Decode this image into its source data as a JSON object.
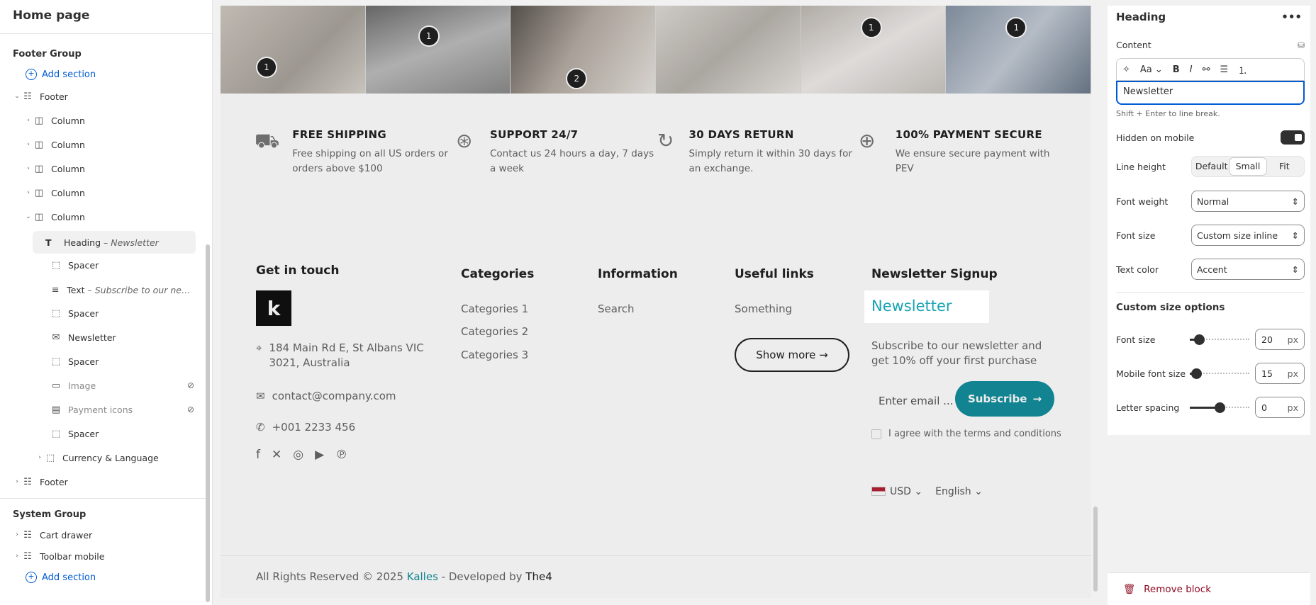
{
  "left_panel": {
    "title": "Home page",
    "footer_group_label": "Footer Group",
    "add_section_top": "Add section",
    "items": [
      {
        "label": "Footer",
        "sub": "",
        "icon": "section-icon"
      },
      {
        "label": "Column",
        "sub": "",
        "icon": "column-icon"
      },
      {
        "label": "Column",
        "sub": "",
        "icon": "column-icon"
      },
      {
        "label": "Column",
        "sub": "",
        "icon": "column-icon"
      },
      {
        "label": "Column",
        "sub": "",
        "icon": "column-icon"
      },
      {
        "label": "Column",
        "sub": "",
        "icon": "column-icon"
      },
      {
        "label": "Heading",
        "sub": "– Newsletter",
        "icon": "text-heading-icon"
      },
      {
        "label": "Spacer",
        "sub": "",
        "icon": "spacer-icon"
      },
      {
        "label": "Text",
        "sub": "– Subscribe to our newsl...",
        "icon": "paragraph-icon"
      },
      {
        "label": "Spacer",
        "sub": "",
        "icon": "spacer-icon"
      },
      {
        "label": "Newsletter",
        "sub": "",
        "icon": "email-icon"
      },
      {
        "label": "Spacer",
        "sub": "",
        "icon": "spacer-icon"
      },
      {
        "label": "Image",
        "sub": "",
        "icon": "image-icon"
      },
      {
        "label": "Payment icons",
        "sub": "",
        "icon": "payment-icon"
      },
      {
        "label": "Spacer",
        "sub": "",
        "icon": "spacer-icon"
      },
      {
        "label": "Currency & Language",
        "sub": "",
        "icon": "spacer-icon"
      },
      {
        "label": "Footer",
        "sub": "",
        "icon": "section-icon"
      }
    ],
    "system_group_label": "System Group",
    "system_items": [
      {
        "label": "Cart drawer",
        "icon": "section-icon"
      },
      {
        "label": "Toolbar mobile",
        "icon": "section-icon"
      }
    ],
    "add_section_bottom": "Add section"
  },
  "preview": {
    "photo_hotspots": [
      "1",
      "1",
      "2",
      "1",
      "1"
    ],
    "features": [
      {
        "title": "FREE SHIPPING",
        "text": "Free shipping on all US orders or orders above $100",
        "icon": "truck-icon"
      },
      {
        "title": "SUPPORT 24/7",
        "text": "Contact us 24 hours a day, 7 days a week",
        "icon": "lifebuoy-icon"
      },
      {
        "title": "30 DAYS RETURN",
        "text": "Simply return it within 30 days for an exchange.",
        "icon": "return-icon"
      },
      {
        "title": "100% PAYMENT SECURE",
        "text": "We ensure secure payment with PEV",
        "icon": "secure-icon"
      }
    ],
    "contact": {
      "heading": "Get in touch",
      "logo": "k",
      "address": "184 Main Rd E, St Albans VIC 3021, Australia",
      "email": "contact@company.com",
      "phone": "+001 2233 456"
    },
    "categories": {
      "heading": "Categories",
      "links": [
        "Categories 1",
        "Categories 2",
        "Categories 3"
      ]
    },
    "information": {
      "heading": "Information",
      "links": [
        "Search"
      ]
    },
    "useful": {
      "heading": "Useful links",
      "links": [
        "Something"
      ],
      "show_more": "Show more →"
    },
    "newsletter": {
      "heading": "Newsletter Signup",
      "highlight": "Newsletter",
      "text": "Subscribe to our newsletter and get 10% off your first purchase",
      "email_placeholder": "Enter email ...",
      "subscribe": "Subscribe",
      "agree": "I agree with the terms and conditions"
    },
    "currency": "USD",
    "language": "English",
    "copyright_prefix": "All Rights Reserved © 2025 ",
    "brand": "Kalles",
    "developed": " - Developed by ",
    "developer": "The4"
  },
  "right_panel": {
    "title": "Heading",
    "content_label": "Content",
    "content_value": "Newsletter",
    "hint": "Shift + Enter to line break.",
    "hidden_mobile_label": "Hidden on mobile",
    "hidden_mobile_on": true,
    "line_height_label": "Line height",
    "line_height_options": [
      "Default",
      "Small",
      "Fit"
    ],
    "line_height_selected": "Small",
    "font_weight_label": "Font weight",
    "font_weight_value": "Normal",
    "font_size_label": "Font size",
    "font_size_value": "Custom size inline",
    "text_color_label": "Text color",
    "text_color_value": "Accent",
    "custom_heading": "Custom size options",
    "cs_font_size_label": "Font size",
    "cs_font_size": "20",
    "cs_mobile_label": "Mobile font size",
    "cs_mobile": "15",
    "cs_spacing_label": "Letter spacing",
    "cs_spacing": "0",
    "unit": "px",
    "remove_block": "Remove block"
  },
  "colors": {
    "accent": "#18a3b2",
    "subscribe": "#148f9c",
    "link": "#005bd3",
    "danger": "#8e0b21"
  }
}
